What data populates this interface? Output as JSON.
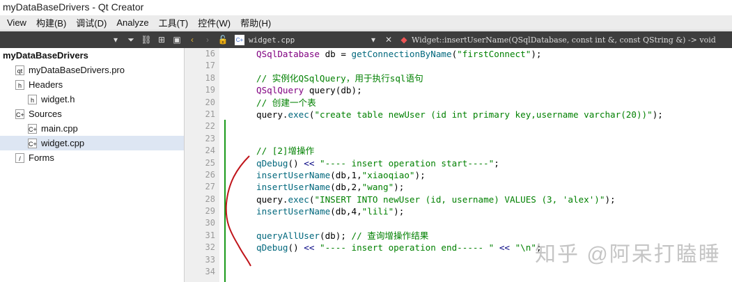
{
  "window": {
    "title": "myDataBaseDrivers - Qt Creator"
  },
  "menu": [
    "View",
    "构建(B)",
    "调试(D)",
    "Analyze",
    "工具(T)",
    "控件(W)",
    "帮助(H)"
  ],
  "toolbar": {
    "file": "widget.cpp",
    "function": "Widget::insertUserName(QSqlDatabase, const int &, const QString &) -> void"
  },
  "tree": [
    {
      "label": "myDataBaseDrivers",
      "icon": "project",
      "indent": 0,
      "bold": true
    },
    {
      "label": "myDataBaseDrivers.pro",
      "icon": "pro",
      "indent": 1
    },
    {
      "label": "Headers",
      "icon": "h-folder",
      "indent": 1
    },
    {
      "label": "widget.h",
      "icon": "h",
      "indent": 2
    },
    {
      "label": "Sources",
      "icon": "cpp-folder",
      "indent": 1
    },
    {
      "label": "main.cpp",
      "icon": "cpp",
      "indent": 2
    },
    {
      "label": "widget.cpp",
      "icon": "cpp",
      "indent": 2,
      "selected": true
    },
    {
      "label": "Forms",
      "icon": "forms",
      "indent": 1
    }
  ],
  "lines": [
    "16",
    "17",
    "18",
    "19",
    "20",
    "21",
    "22",
    "23",
    "24",
    "25",
    "26",
    "27",
    "28",
    "29",
    "30",
    "31",
    "32",
    "33",
    "34"
  ],
  "code": [
    [
      [
        "ty",
        "QSqlDatabase"
      ],
      [
        "tx",
        " db = "
      ],
      [
        "fn",
        "getConnectionByName"
      ],
      [
        "tx",
        "("
      ],
      [
        "st",
        "\"firstConnect\""
      ],
      [
        "tx",
        ");"
      ]
    ],
    [],
    [
      [
        "cm",
        "// 实例化QSqlQuery，用于执行sql语句"
      ]
    ],
    [
      [
        "ty",
        "QSqlQuery"
      ],
      [
        "tx",
        " query(db);"
      ]
    ],
    [
      [
        "cm",
        "// 创建一个表"
      ]
    ],
    [
      [
        "tx",
        "query."
      ],
      [
        "fn",
        "exec"
      ],
      [
        "tx",
        "("
      ],
      [
        "st",
        "\"create table newUser (id int primary key,username varchar(20))\""
      ],
      [
        "tx",
        ");"
      ]
    ],
    [],
    [],
    [
      [
        "cm",
        "// [2]增操作"
      ]
    ],
    [
      [
        "fn",
        "qDebug"
      ],
      [
        "tx",
        "() "
      ],
      [
        "op",
        "<<"
      ],
      [
        "tx",
        " "
      ],
      [
        "st",
        "\"---- insert operation start----\""
      ],
      [
        "tx",
        ";"
      ]
    ],
    [
      [
        "fn",
        "insertUserName"
      ],
      [
        "tx",
        "(db,1,"
      ],
      [
        "st",
        "\"xiaoqiao\""
      ],
      [
        "tx",
        ");"
      ]
    ],
    [
      [
        "fn",
        "insertUserName"
      ],
      [
        "tx",
        "(db,2,"
      ],
      [
        "st",
        "\"wang\""
      ],
      [
        "tx",
        ");"
      ]
    ],
    [
      [
        "tx",
        "query."
      ],
      [
        "fn",
        "exec"
      ],
      [
        "tx",
        "("
      ],
      [
        "st",
        "\"INSERT INTO newUser (id, username) VALUES (3, 'alex')\""
      ],
      [
        "tx",
        ");"
      ]
    ],
    [
      [
        "fn",
        "insertUserName"
      ],
      [
        "tx",
        "(db,4,"
      ],
      [
        "st",
        "\"lili\""
      ],
      [
        "tx",
        ");"
      ]
    ],
    [],
    [
      [
        "fn",
        "queryAllUser"
      ],
      [
        "tx",
        "(db); "
      ],
      [
        "cm",
        "// 查询增操作结果"
      ]
    ],
    [
      [
        "fn",
        "qDebug"
      ],
      [
        "tx",
        "() "
      ],
      [
        "op",
        "<<"
      ],
      [
        "tx",
        " "
      ],
      [
        "st",
        "\"---- insert operation end----- \""
      ],
      [
        "tx",
        " "
      ],
      [
        "op",
        "<<"
      ],
      [
        "tx",
        " "
      ],
      [
        "st",
        "\"\\n\""
      ],
      [
        "tx",
        ";"
      ]
    ],
    [],
    []
  ],
  "watermark": "知乎 @阿呆打瞌睡"
}
